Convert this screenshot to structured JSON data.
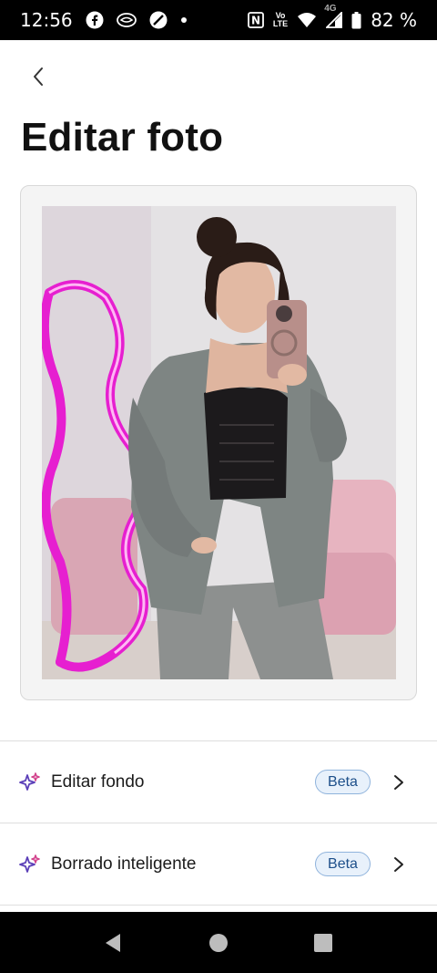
{
  "status_bar": {
    "time": "12:56",
    "left_icons": [
      "facebook-icon",
      "messaging-app-icon",
      "no-entry-icon",
      "dot-icon"
    ],
    "nfc_label": "N",
    "volte_top": "Vo",
    "volte_bottom": "LTE",
    "network": "4G",
    "battery": "82 %"
  },
  "header": {
    "back_icon": "chevron-left-icon",
    "title": "Editar foto"
  },
  "photo": {
    "description_icon": "photo-preview"
  },
  "options": [
    {
      "icon": "sparkles-icon",
      "label": "Editar fondo",
      "badge": "Beta",
      "chevron": "chevron-right-icon"
    },
    {
      "icon": "sparkles-icon",
      "label": "Borrado inteligente",
      "badge": "Beta",
      "chevron": "chevron-right-icon"
    }
  ],
  "nav_bar": {
    "back": "back-triangle-icon",
    "home": "home-circle-icon",
    "recents": "recents-square-icon"
  },
  "colors": {
    "accent_sparkle_purple": "#5b3fb8",
    "accent_sparkle_pink": "#d2428c",
    "badge_bg": "#e8f1fb",
    "badge_border": "#8fb3dc",
    "badge_text": "#1d4f8a"
  }
}
